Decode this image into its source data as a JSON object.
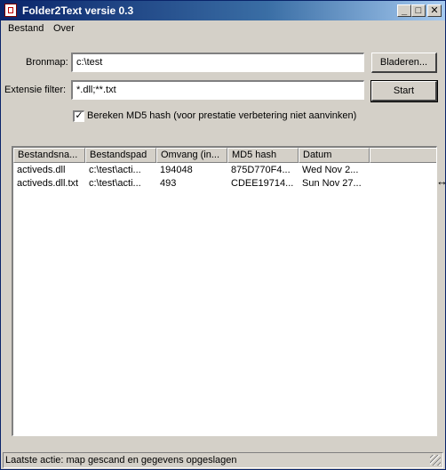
{
  "window": {
    "title": "Folder2Text versie 0.3",
    "controls": {
      "minimize": "_",
      "maximize": "□",
      "close": "✕"
    }
  },
  "menu": {
    "file": "Bestand",
    "about": "Over"
  },
  "form": {
    "source_label": "Bronmap:",
    "source_value": "c:\\test",
    "browse_button": "Bladeren...",
    "ext_label": "Extensie filter:",
    "ext_value": "*.dll;**.txt",
    "start_button": "Start",
    "md5_checkbox_label": "Bereken MD5 hash (voor prestatie verbetering niet aanvinken)",
    "md5_checked": true
  },
  "table": {
    "columns": [
      "Bestandsna...",
      "Bestandspad",
      "Omvang (in...",
      "MD5 hash",
      "Datum"
    ],
    "rows": [
      [
        "activeds.dll",
        "c:\\test\\acti...",
        "194048",
        "875D770F4...",
        "Wed Nov 2..."
      ],
      [
        "activeds.dll.txt",
        "c:\\test\\acti...",
        "493",
        "CDEE19714...",
        "Sun Nov 27..."
      ]
    ]
  },
  "status": {
    "text": "Laatste actie: map gescand en gegevens opgeslagen"
  }
}
